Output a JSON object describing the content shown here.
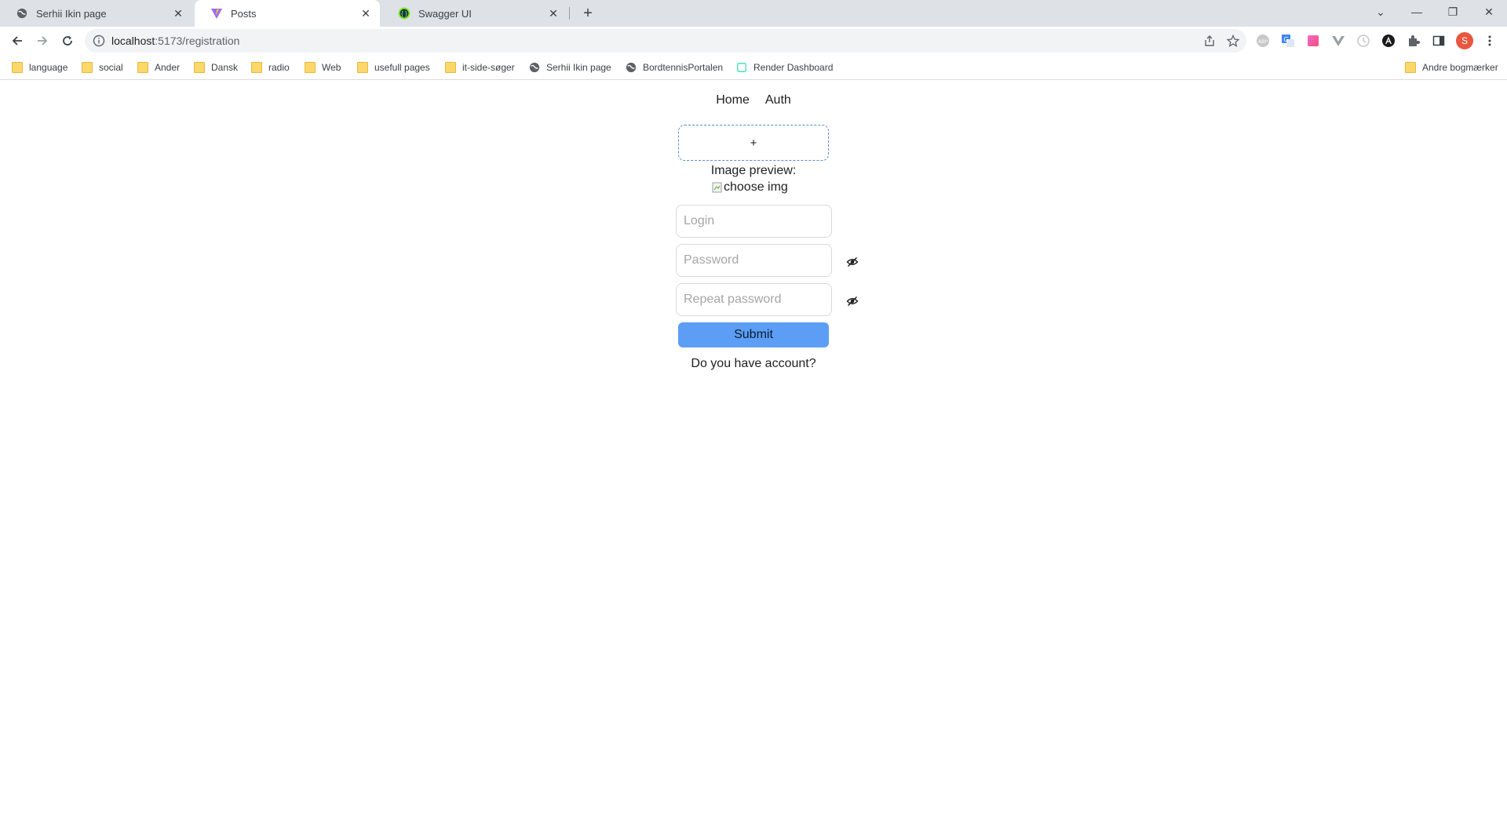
{
  "browser": {
    "tabs": [
      {
        "title": "Serhii Ikin page",
        "icon": "globe-icon"
      },
      {
        "title": "Posts",
        "icon": "vite-icon"
      },
      {
        "title": "Swagger UI",
        "icon": "swagger-icon"
      }
    ],
    "url_host": "localhost",
    "url_path": ":5173/registration",
    "profile_initial": "S",
    "bookmarks": [
      {
        "label": "language",
        "icon": "folder-icon"
      },
      {
        "label": "social",
        "icon": "folder-icon"
      },
      {
        "label": "Ander",
        "icon": "folder-icon"
      },
      {
        "label": "Dansk",
        "icon": "folder-icon"
      },
      {
        "label": "radio",
        "icon": "folder-icon"
      },
      {
        "label": "Web",
        "icon": "folder-icon"
      },
      {
        "label": "usefull pages",
        "icon": "folder-icon"
      },
      {
        "label": "it-side-søger",
        "icon": "folder-icon"
      },
      {
        "label": "Serhii Ikin page",
        "icon": "globe-icon"
      },
      {
        "label": "BordtennisPortalen",
        "icon": "globe-icon"
      },
      {
        "label": "Render Dashboard",
        "icon": "render-icon"
      }
    ],
    "other_bookmarks": "Andre bogmærker"
  },
  "page": {
    "nav": {
      "home": "Home",
      "auth": "Auth"
    },
    "upload_label": "+",
    "preview_label": "Image preview:",
    "preview_alt": "choose img",
    "login_placeholder": "Login",
    "password_placeholder": "Password",
    "repeat_password_placeholder": "Repeat password",
    "submit_label": "Submit",
    "account_text": "Do you have account?"
  },
  "colors": {
    "submit_bg": "#5c9ef5",
    "upload_border": "#5b8ad6",
    "profile_bg": "#e8573f"
  }
}
